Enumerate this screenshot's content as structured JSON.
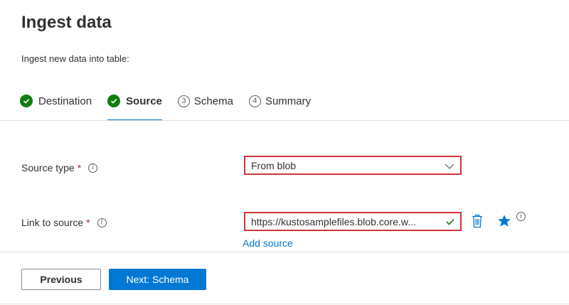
{
  "page": {
    "title": "Ingest data",
    "subtitle": "Ingest new data into table:"
  },
  "steps": [
    {
      "label": "Destination",
      "state": "complete"
    },
    {
      "label": "Source",
      "state": "active"
    },
    {
      "label": "Schema",
      "state": "pending",
      "number": "3"
    },
    {
      "label": "Summary",
      "state": "pending",
      "number": "4"
    }
  ],
  "form": {
    "source_type": {
      "label": "Source type",
      "required_mark": "*",
      "value": "From blob"
    },
    "link_to_source": {
      "label": "Link to source",
      "required_mark": "*",
      "value": "https://kustosamplefiles.blob.core.w..."
    },
    "add_source_label": "Add source"
  },
  "footer": {
    "previous_label": "Previous",
    "next_label": "Next: Schema"
  },
  "colors": {
    "accent": "#0078d4",
    "success": "#107c10",
    "highlight_border": "#d13438",
    "required": "#a4262c"
  }
}
